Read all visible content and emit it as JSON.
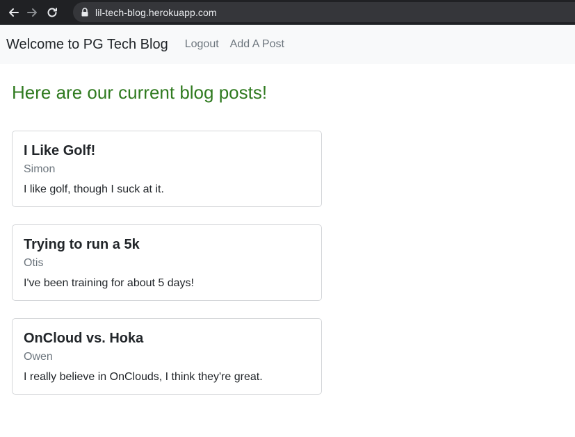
{
  "browser": {
    "url": "lil-tech-blog.herokuapp.com"
  },
  "navbar": {
    "brand": "Welcome to PG Tech Blog",
    "links": [
      {
        "label": "Logout"
      },
      {
        "label": "Add A Post"
      }
    ]
  },
  "main": {
    "heading": "Here are our current blog posts!",
    "posts": [
      {
        "title": "I Like Golf!",
        "author": "Simon",
        "body": "I like golf, though I suck at it."
      },
      {
        "title": "Trying to run a 5k",
        "author": "Otis",
        "body": "I've been training for about 5 days!"
      },
      {
        "title": "OnCloud vs. Hoka",
        "author": "Owen",
        "body": "I really believe in OnClouds, I think they're great."
      }
    ]
  },
  "colors": {
    "heading": "#2f7a1f",
    "navbar_bg": "#f8f9fa",
    "browser_bg": "#202124"
  },
  "icons": [
    "back-arrow-icon",
    "forward-arrow-icon",
    "reload-icon",
    "lock-icon"
  ]
}
